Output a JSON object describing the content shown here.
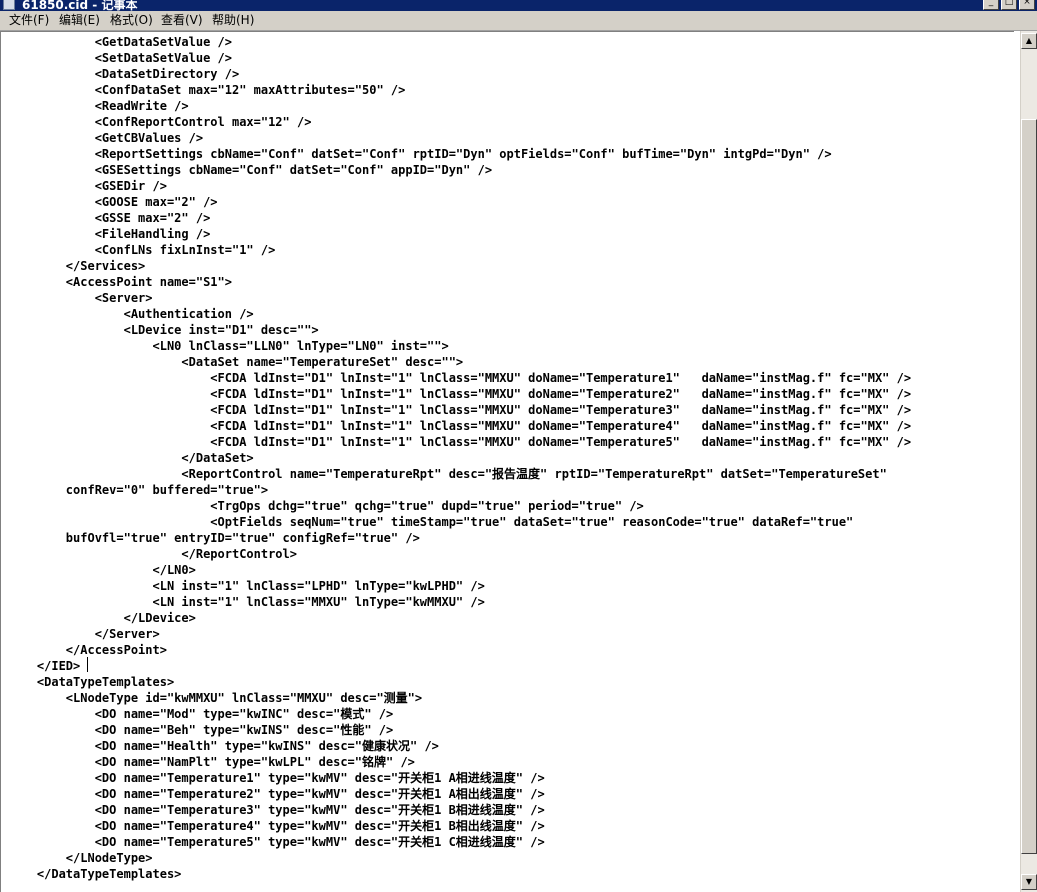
{
  "window": {
    "title": "61850.cid - 记事本",
    "buttons": {
      "minimize": "_",
      "maximize": "□",
      "close": "×"
    }
  },
  "menu": [
    {
      "label": "文件(F)"
    },
    {
      "label": "编辑(E)"
    },
    {
      "label": "格式(O)"
    },
    {
      "label": "查看(V)"
    },
    {
      "label": "帮助(H)"
    }
  ],
  "scrollbar": {
    "up_arrow": "▲",
    "down_arrow": "▼"
  },
  "editor": {
    "lines": [
      "            <GetDataSetValue />",
      "            <SetDataSetValue />",
      "            <DataSetDirectory />",
      "            <ConfDataSet max=\"12\" maxAttributes=\"50\" />",
      "            <ReadWrite />",
      "            <ConfReportControl max=\"12\" />",
      "            <GetCBValues />",
      "            <ReportSettings cbName=\"Conf\" datSet=\"Conf\" rptID=\"Dyn\" optFields=\"Conf\" bufTime=\"Dyn\" intgPd=\"Dyn\" />",
      "            <GSESettings cbName=\"Conf\" datSet=\"Conf\" appID=\"Dyn\" />",
      "            <GSEDir />",
      "            <GOOSE max=\"2\" />",
      "            <GSSE max=\"2\" />",
      "            <FileHandling />",
      "            <ConfLNs fixLnInst=\"1\" />",
      "        </Services>",
      "        <AccessPoint name=\"S1\">",
      "            <Server>",
      "                <Authentication />",
      "                <LDevice inst=\"D1\" desc=\"\">",
      "                    <LN0 lnClass=\"LLN0\" lnType=\"LN0\" inst=\"\">",
      "                        <DataSet name=\"TemperatureSet\" desc=\"\">",
      "                            <FCDA ldInst=\"D1\" lnInst=\"1\" lnClass=\"MMXU\" doName=\"Temperature1\"   daName=\"instMag.f\" fc=\"MX\" />",
      "                            <FCDA ldInst=\"D1\" lnInst=\"1\" lnClass=\"MMXU\" doName=\"Temperature2\"   daName=\"instMag.f\" fc=\"MX\" />",
      "                            <FCDA ldInst=\"D1\" lnInst=\"1\" lnClass=\"MMXU\" doName=\"Temperature3\"   daName=\"instMag.f\" fc=\"MX\" />",
      "                            <FCDA ldInst=\"D1\" lnInst=\"1\" lnClass=\"MMXU\" doName=\"Temperature4\"   daName=\"instMag.f\" fc=\"MX\" />",
      "                            <FCDA ldInst=\"D1\" lnInst=\"1\" lnClass=\"MMXU\" doName=\"Temperature5\"   daName=\"instMag.f\" fc=\"MX\" />",
      "                        </DataSet>",
      "                        <ReportControl name=\"TemperatureRpt\" desc=\"报告温度\" rptID=\"TemperatureRpt\" datSet=\"TemperatureSet\"",
      "        confRev=\"0\" buffered=\"true\">",
      "                            <TrgOps dchg=\"true\" qchg=\"true\" dupd=\"true\" period=\"true\" />",
      "                            <OptFields seqNum=\"true\" timeStamp=\"true\" dataSet=\"true\" reasonCode=\"true\" dataRef=\"true\"",
      "        bufOvfl=\"true\" entryID=\"true\" configRef=\"true\" />",
      "                        </ReportControl>",
      "                    </LN0>",
      "                    <LN inst=\"1\" lnClass=\"LPHD\" lnType=\"kwLPHD\" />",
      "                    <LN inst=\"1\" lnClass=\"MMXU\" lnType=\"kwMMXU\" />",
      "                </LDevice>",
      "            </Server>",
      "        </AccessPoint>",
      "    </IED>",
      "    <DataTypeTemplates>",
      "        <LNodeType id=\"kwMMXU\" lnClass=\"MMXU\" desc=\"测量\">",
      "            <DO name=\"Mod\" type=\"kwINC\" desc=\"模式\" />",
      "            <DO name=\"Beh\" type=\"kwINS\" desc=\"性能\" />",
      "            <DO name=\"Health\" type=\"kwINS\" desc=\"健康状况\" />",
      "            <DO name=\"NamPlt\" type=\"kwLPL\" desc=\"铭牌\" />",
      "            <DO name=\"Temperature1\" type=\"kwMV\" desc=\"开关柜1 A相进线温度\" />",
      "            <DO name=\"Temperature2\" type=\"kwMV\" desc=\"开关柜1 A相出线温度\" />",
      "            <DO name=\"Temperature3\" type=\"kwMV\" desc=\"开关柜1 B相进线温度\" />",
      "            <DO name=\"Temperature4\" type=\"kwMV\" desc=\"开关柜1 B相出线温度\" />",
      "            <DO name=\"Temperature5\" type=\"kwMV\" desc=\"开关柜1 C相进线温度\" />",
      "        </LNodeType>",
      "    </DataTypeTemplates>"
    ]
  }
}
